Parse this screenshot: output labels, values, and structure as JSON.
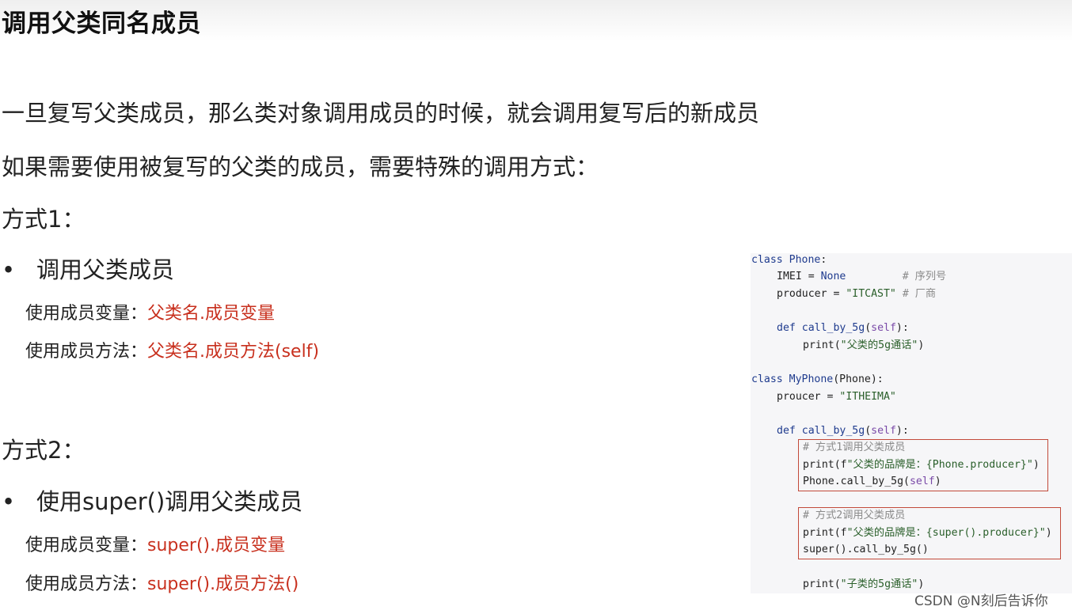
{
  "title": "调用父类同名成员",
  "para1": "一旦复写父类成员，那么类对象调用成员的时候，就会调用复写后的新成员",
  "para2": "如果需要使用被复写的父类的成员，需要特殊的调用方式：",
  "method1": {
    "heading": "方式1：",
    "bullet": "调用父类成员",
    "var_label": "使用成员变量：",
    "var_value": "父类名.成员变量",
    "func_label": "使用成员方法：",
    "func_value": "父类名.成员方法(self)"
  },
  "method2": {
    "heading": "方式2：",
    "bullet": "使用super()调用父类成员",
    "var_label": "使用成员变量：",
    "var_value": "super().成员变量",
    "func_label": "使用成员方法：",
    "func_value": "super().成员方法()"
  },
  "bullet_symbol": "•",
  "code": {
    "l1_kw": "class",
    "l1_name": "Phone",
    "l1_tail": ":",
    "l2_a": "IMEI = ",
    "l2_b": "None",
    "l2_c": "         # 序列号",
    "l3_a": "producer = ",
    "l3_b": "\"ITCAST\"",
    "l3_c": " # 厂商",
    "l4_kw": "def",
    "l4_name": "call_by_5g",
    "l4_open": "(",
    "l4_self": "self",
    "l4_close": "):",
    "l5_a": "print(",
    "l5_b": "\"父类的5g通话\"",
    "l5_c": ")",
    "l6_kw": "class",
    "l6_name": "MyPhone",
    "l6_tail": "(Phone):",
    "l7_a": "proucer = ",
    "l7_b": "\"ITHEIMA\"",
    "l8_kw": "def",
    "l8_name": "call_by_5g",
    "l8_open": "(",
    "l8_self": "self",
    "l8_close": "):",
    "l9": "# 方式1调用父类成员",
    "l10_a": "print(f",
    "l10_b": "\"父类的品牌是：{Phone.producer}\"",
    "l10_c": ")",
    "l11_a": "Phone.call_by_5g(",
    "l11_self": "self",
    "l11_c": ")",
    "l12": "# 方式2调用父类成员",
    "l13_a": "print(f",
    "l13_b": "\"父类的品牌是：{super().producer}\"",
    "l13_c": ")",
    "l14": "super().call_by_5g()",
    "l15_a": "print(",
    "l15_b": "\"子类的5g通话\"",
    "l15_c": ")"
  },
  "watermark": "CSDN @N刻后告诉你"
}
